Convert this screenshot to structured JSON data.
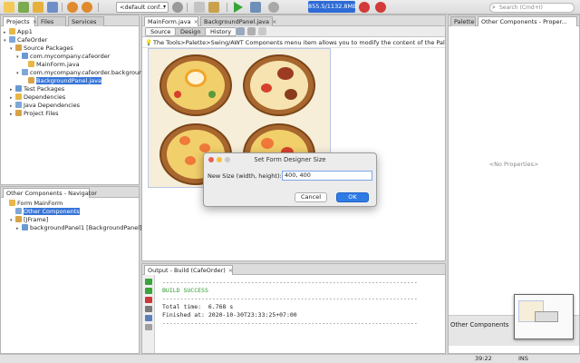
{
  "toolbar": {
    "config_select": "<default conf...",
    "memory": "855.5/1132.8MB",
    "search_placeholder": "Search (Cmd+I)"
  },
  "projects_panel": {
    "tabs": [
      "Projects",
      "Files",
      "Services"
    ],
    "tree": [
      {
        "label": "App1",
        "indent": 0,
        "toggle": "▸"
      },
      {
        "label": "CafeOrder",
        "indent": 0,
        "toggle": "▾"
      },
      {
        "label": "Source Packages",
        "indent": 1,
        "toggle": "▾"
      },
      {
        "label": "com.mycompany.cafeorder",
        "indent": 2,
        "toggle": "▾"
      },
      {
        "label": "MainForm.java",
        "indent": 3,
        "toggle": ""
      },
      {
        "label": "com.mycompany.cafeorder.backgrounds",
        "indent": 2,
        "toggle": "▾"
      },
      {
        "label": "BackgroundPanel.java",
        "indent": 3,
        "toggle": "",
        "selected": true
      },
      {
        "label": "Test Packages",
        "indent": 1,
        "toggle": "▸"
      },
      {
        "label": "Dependencies",
        "indent": 1,
        "toggle": "▸"
      },
      {
        "label": "Java Dependencies",
        "indent": 1,
        "toggle": "▸"
      },
      {
        "label": "Project Files",
        "indent": 1,
        "toggle": "▸"
      }
    ]
  },
  "navigator_panel": {
    "title": "Other Components - Navigator",
    "tree": [
      {
        "label": "Form MainForm",
        "indent": 0,
        "toggle": ""
      },
      {
        "label": "Other Components",
        "indent": 1,
        "toggle": "",
        "selected": true
      },
      {
        "label": "[JFrame]",
        "indent": 1,
        "toggle": "▾"
      },
      {
        "label": "backgroundPanel1 [BackgroundPanel]",
        "indent": 2,
        "toggle": "▸"
      }
    ]
  },
  "editor": {
    "tabs": [
      "MainForm.java",
      "BackgroundPanel.java"
    ],
    "view_buttons": [
      "Source",
      "Design",
      "History"
    ],
    "hint": "The Tools>Palette>Swing/AWT Components menu item allows you to modify the content of the Palette."
  },
  "dialog": {
    "title": "Set Form Designer Size",
    "label": "New Size (width, height):",
    "value": "400, 400",
    "cancel": "Cancel",
    "ok": "OK"
  },
  "output": {
    "title": "Output - Build (CafeOrder)",
    "lines": [
      "------------------------------------------------------------------------",
      "BUILD SUCCESS",
      "------------------------------------------------------------------------",
      "Total time:  6.768 s",
      "Finished at: 2020-10-30T23:33:25+07:00",
      "------------------------------------------------------------------------"
    ]
  },
  "right_panel": {
    "tabs": [
      "Palette",
      "Other Components - Proper..."
    ],
    "empty_text": "<No Properties>",
    "footer_label": "Other Components"
  },
  "status": {
    "position": "39:22",
    "mode": "INS"
  },
  "colors": {
    "accent": "#3875d7",
    "build_success": "#2f9a2f",
    "memory_bar": "#2e6bd6"
  }
}
